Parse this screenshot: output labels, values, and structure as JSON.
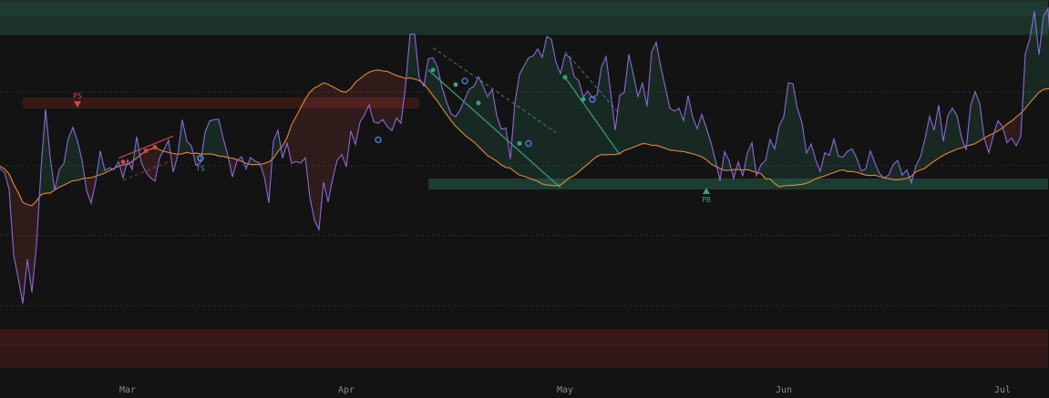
{
  "chart_data": {
    "type": "line",
    "title": "",
    "xlabel": "",
    "ylabel": "",
    "x_ticks": [
      "Mar",
      "Apr",
      "May",
      "Jun",
      "Jul"
    ],
    "x_tick_index": [
      28,
      76,
      124,
      172,
      220
    ],
    "ylim": [
      0,
      100
    ],
    "grid": "horizontal-dashed",
    "colors": {
      "background": "#131313",
      "oscillator": "#8a6ad8",
      "signal": "#e08a3a",
      "bull_zone": "#1f3d33",
      "bear_zone": "#3b1818",
      "bull_accent": "#3aa082",
      "bear_accent": "#d04848",
      "marker_blue": "#4a78c8"
    },
    "series": [
      {
        "role": "oscillator",
        "values": [
          54.2,
          53.1,
          48.6,
          30.7,
          24.4,
          17.5,
          29.5,
          20.6,
          33.3,
          53.9,
          70.3,
          57.4,
          48.3,
          53.9,
          55.5,
          62.4,
          65.4,
          61.7,
          56.5,
          48.2,
          44.8,
          50.6,
          59.0,
          53.7,
          54.4,
          53.9,
          56.1,
          51.7,
          56.5,
          53.9,
          62.9,
          55.8,
          53.3,
          51.7,
          50.8,
          57.0,
          59.4,
          61.9,
          53.2,
          57.7,
          67.4,
          61.6,
          60.4,
          55.1,
          55.8,
          64.0,
          67.1,
          67.5,
          67.6,
          62.3,
          57.8,
          51.9,
          56.3,
          57.4,
          54.1,
          57.2,
          56.2,
          55.7,
          52.0,
          44.9,
          61.6,
          64.6,
          57.0,
          61.1,
          55.6,
          56.1,
          55.7,
          57.1,
          46.3,
          40.2,
          37.6,
          50.5,
          45.1,
          51.4,
          56.4,
          58.0,
          54.7,
          64.4,
          60.7,
          66.8,
          68.8,
          71.5,
          66.9,
          66.5,
          67.5,
          65.6,
          64.5,
          67.9,
          66.5,
          76.7,
          90.7,
          90.7,
          78.8,
          76.6,
          84.0,
          84.3,
          81.8,
          76.2,
          72.3,
          69.0,
          68.3,
          70.2,
          73.1,
          75.8,
          76.5,
          79.1,
          76.7,
          73.7,
          75.7,
          68.7,
          64.9,
          65.2,
          56.8,
          72.1,
          79.8,
          82.1,
          84.3,
          84.8,
          86.7,
          84.4,
          90.1,
          89.3,
          83.1,
          80.0,
          85.2,
          84.5,
          79.2,
          78.1,
          73.7,
          75.3,
          73.4,
          74.2,
          81.8,
          84.6,
          75.0,
          64.6,
          74.1,
          74.9,
          85.2,
          79.6,
          73.8,
          77.4,
          71.1,
          85.9,
          88.5,
          81.9,
          76.3,
          70.6,
          69.8,
          70.6,
          67.2,
          74.0,
          68.2,
          65.0,
          68.9,
          65.3,
          61.3,
          56.4,
          50.9,
          58.8,
          56.3,
          51.5,
          56.0,
          52.1,
          58.4,
          61.2,
          52.3,
          55.2,
          56.4,
          62.1,
          59.5,
          65.8,
          68.3,
          77.5,
          77.2,
          70.5,
          66.6,
          58.4,
          60.9,
          56.6,
          53.4,
          58.5,
          57.8,
          62.2,
          57.5,
          57.3,
          58.9,
          59.5,
          57.0,
          53.5,
          54.1,
          59.0,
          55.7,
          52.8,
          51.7,
          52.4,
          55.2,
          56.4,
          52.4,
          53.8,
          50.3,
          54.9,
          57.4,
          62.3,
          68.4,
          64.6,
          71.4,
          61.6,
          68.6,
          70.6,
          68.6,
          62.7,
          59.2,
          71.3,
          75.1,
          71.8,
          62.4,
          58.5,
          63.2,
          67.2,
          65.6,
          61.2,
          62.5,
          60.4,
          62.9,
          85.4,
          89.5,
          96.9,
          85.1,
          95.7,
          97.7,
          77.4,
          78.7,
          70.1,
          77.0,
          72.2,
          76.4
        ]
      },
      {
        "role": "signal",
        "values": [
          54.8,
          54.1,
          52.7,
          49.9,
          47.7,
          45.0,
          44.4,
          44.1,
          45.4,
          47.1,
          47.5,
          47.5,
          48.4,
          49.1,
          49.7,
          50.3,
          50.9,
          51.0,
          51.4,
          51.6,
          51.7,
          52.1,
          52.5,
          53.0,
          53.6,
          54.2,
          54.8,
          55.2,
          55.3,
          56.1,
          57.0,
          58.1,
          58.9,
          59.5,
          59.8,
          59.3,
          58.8,
          58.6,
          58.3,
          58.1,
          58.2,
          58.6,
          58.3,
          58.4,
          58.2,
          58.1,
          58.2,
          58.0,
          57.6,
          57.5,
          57.2,
          57.0,
          56.6,
          56.2,
          55.6,
          55.3,
          55.3,
          55.3,
          55.6,
          56.0,
          57.0,
          58.8,
          60.4,
          62.6,
          66.1,
          68.4,
          70.7,
          73.1,
          74.9,
          76.1,
          76.7,
          77.5,
          77.1,
          76.4,
          75.8,
          75.1,
          75.0,
          76.0,
          77.6,
          78.6,
          79.6,
          80.4,
          80.8,
          81.0,
          80.7,
          80.6,
          80.0,
          79.5,
          79.1,
          78.7,
          78.8,
          78.5,
          78.1,
          77.2,
          75.7,
          74.0,
          72.5,
          70.7,
          68.9,
          67.2,
          65.7,
          64.5,
          63.3,
          62.3,
          61.4,
          60.2,
          59.0,
          57.7,
          57.0,
          56.2,
          55.2,
          54.5,
          54.3,
          53.3,
          52.4,
          52.1,
          51.6,
          51.2,
          50.7,
          50.0,
          49.7,
          49.6,
          49.5,
          49.7,
          50.7,
          51.7,
          52.3,
          53.3,
          54.4,
          55.4,
          56.5,
          57.5,
          58.0,
          57.9,
          58.0,
          58.0,
          58.3,
          59.1,
          59.5,
          60.0,
          60.5,
          61.0,
          60.9,
          60.5,
          60.5,
          60.1,
          59.7,
          59.2,
          59.1,
          58.9,
          58.8,
          58.5,
          58.2,
          57.8,
          57.4,
          56.6,
          55.5,
          54.8,
          54.2,
          53.7,
          53.7,
          53.9,
          53.9,
          53.8,
          53.9,
          53.5,
          53.2,
          52.8,
          51.4,
          51.3,
          50.1,
          49.2,
          49.5,
          49.6,
          49.6,
          49.8,
          49.9,
          50.2,
          50.7,
          51.4,
          51.8,
          52.2,
          52.7,
          53.1,
          53.6,
          53.8,
          53.4,
          53.4,
          53.2,
          52.8,
          52.4,
          52.3,
          52.4,
          52.0,
          51.6,
          51.5,
          51.2,
          51.1,
          51.3,
          51.5,
          52.1,
          53.3,
          53.8,
          54.3,
          55.3,
          56.2,
          57.0,
          57.8,
          58.4,
          58.9,
          59.5,
          59.8,
          60.3,
          60.6,
          61.0,
          61.7,
          62.4,
          63.2,
          63.8,
          64.4,
          65.2,
          66.3,
          67.1,
          68.2,
          69.2,
          70.5,
          72.1,
          73.5,
          74.9,
          75.7,
          75.9,
          75.8
        ]
      }
    ],
    "zones": [
      {
        "kind": "bull",
        "y0": 95.5,
        "y1": 100.5,
        "x0": 0,
        "x1": 229
      },
      {
        "kind": "bull",
        "y0": 90.5,
        "y1": 95.5,
        "x0": 0,
        "x1": 229
      },
      {
        "kind": "bear",
        "y0": 70.5,
        "y1": 73.5,
        "x0": 5,
        "x1": 91
      },
      {
        "kind": "bull",
        "y0": 48.5,
        "y1": 51.5,
        "x0": 94,
        "x1": 229
      },
      {
        "kind": "bear",
        "y0": 5.5,
        "y1": 10.5,
        "x0": 0,
        "x1": 229
      },
      {
        "kind": "bear",
        "y0": 0,
        "y1": 5.5,
        "x0": 0,
        "x1": 229
      }
    ],
    "guide_lines": [
      17,
      36,
      55,
      75
    ],
    "signals": [
      {
        "label": "PS",
        "x": 17,
        "y": 71,
        "side": "above",
        "color": "#d04848"
      },
      {
        "label": "TS",
        "x": 44,
        "y": 57,
        "side": "below",
        "color": "#4a90c8"
      },
      {
        "label": "PB",
        "x": 155,
        "y": 49,
        "side": "below",
        "color": "#3aa082"
      }
    ],
    "trendlines": [
      {
        "x0": 94,
        "y0": 81,
        "x1": 123,
        "y1": 49,
        "color": "#3aa082",
        "style": "solid"
      },
      {
        "x0": 124,
        "y0": 79,
        "x1": 136,
        "y1": 58,
        "color": "#3aa082",
        "style": "solid"
      },
      {
        "x0": 26,
        "y0": 57,
        "x1": 38,
        "y1": 63,
        "color": "#d04848",
        "style": "solid"
      },
      {
        "x0": 95,
        "y0": 87,
        "x1": 122,
        "y1": 64,
        "color": "#3b6a5e",
        "style": "dashed"
      },
      {
        "x0": 124,
        "y0": 86,
        "x1": 136,
        "y1": 69,
        "color": "#3b6a5e",
        "style": "dashed"
      },
      {
        "x0": 27,
        "y0": 51,
        "x1": 37,
        "y1": 56,
        "color": "#6b3434",
        "style": "dashed"
      }
    ],
    "markers": [
      {
        "x": 95,
        "y": 81,
        "color": "#3aa082",
        "r": 2
      },
      {
        "x": 100,
        "y": 77,
        "color": "#3aa082",
        "r": 2
      },
      {
        "x": 105,
        "y": 72,
        "color": "#3aa082",
        "r": 2
      },
      {
        "x": 114,
        "y": 61,
        "color": "#3aa082",
        "r": 2
      },
      {
        "x": 124,
        "y": 79,
        "color": "#3aa082",
        "r": 2
      },
      {
        "x": 128,
        "y": 73,
        "color": "#3aa082",
        "r": 2
      },
      {
        "x": 27,
        "y": 56,
        "color": "#d04848",
        "r": 2
      },
      {
        "x": 32,
        "y": 59,
        "color": "#d04848",
        "r": 2
      },
      {
        "x": 34,
        "y": 60,
        "color": "#d04848",
        "r": 2
      },
      {
        "x": 102,
        "y": 78,
        "color": "#4a78c8",
        "r": 3
      },
      {
        "x": 130,
        "y": 73,
        "color": "#4a78c8",
        "r": 3
      },
      {
        "x": 116,
        "y": 61,
        "color": "#4a78c8",
        "r": 3
      },
      {
        "x": 83,
        "y": 62,
        "color": "#4a78c8",
        "r": 3
      },
      {
        "x": 44,
        "y": 57,
        "color": "#4a90c8",
        "r": 3
      }
    ]
  }
}
